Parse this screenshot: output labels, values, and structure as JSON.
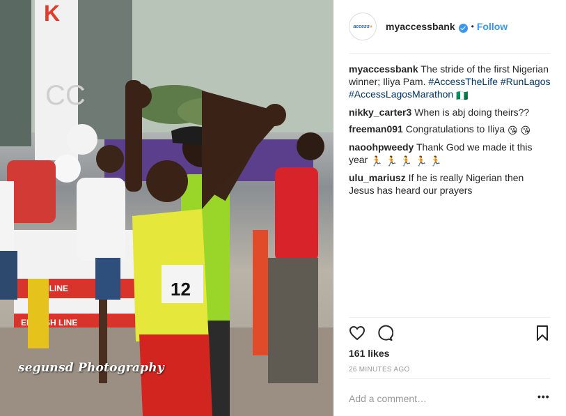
{
  "post": {
    "account": "myaccessbank",
    "avatar_text": "access",
    "avatar_chevrons": "»",
    "verified_icon": "verified-check-icon",
    "dot": "•",
    "follow_label": "Follow",
    "photo_watermark": "segunsd Photography",
    "caption": {
      "user": "myaccessbank",
      "text": "The stride of the first Nigerian winner; Iliya Pam.",
      "hashtags": "#AccessTheLife #RunLagos #AccessLagosMarathon",
      "emoji": "🇳🇬"
    },
    "comments": [
      {
        "user": "nikky_carter3",
        "text": "When is abj doing theirs??"
      },
      {
        "user": "freeman091",
        "text": "Congratulations to Iliya",
        "emoji": "😘 😘"
      },
      {
        "user": "naoohpweedy",
        "text": "Thank God we made it this year",
        "emoji": "🏃 🏃 🏃 🏃 🏃"
      },
      {
        "user": "ulu_mariusz",
        "text": "If he is really Nigerian then Jesus has heard our prayers"
      }
    ],
    "likes": "161 likes",
    "time": "26 MINUTES AGO",
    "add_comment_placeholder": "Add a comment…",
    "more_label": "•••",
    "colors": {
      "link": "#3897f0",
      "hashtag": "#003569",
      "brand_blue": "#1e63b6",
      "brand_orange": "#f47c20"
    }
  }
}
